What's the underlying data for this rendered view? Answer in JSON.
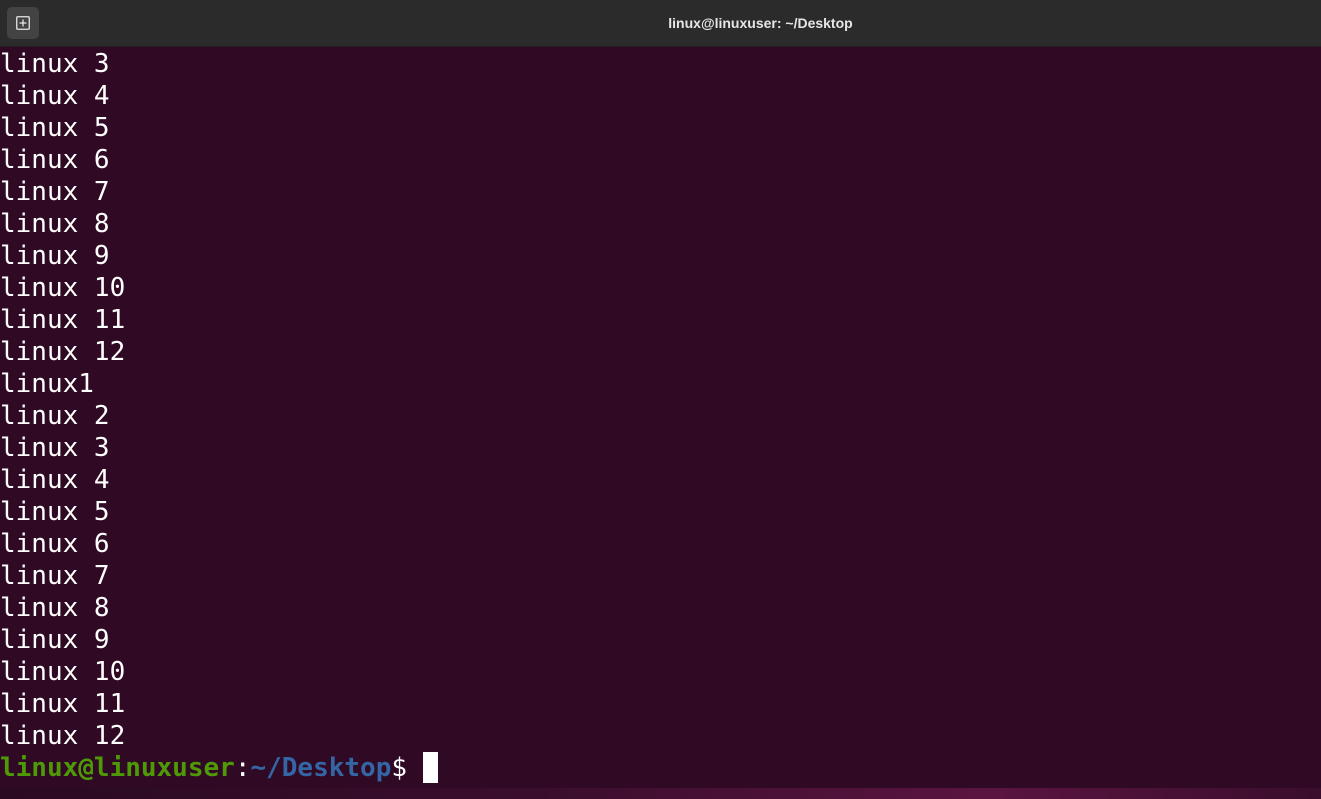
{
  "window": {
    "title": "linux@linuxuser: ~/Desktop"
  },
  "icons": {
    "new_tab": "new-tab-icon"
  },
  "colors": {
    "background": "#300a24",
    "titlebar": "#2b2b2b",
    "prompt_user": "#4e9a06",
    "prompt_path": "#3465a4",
    "text": "#ffffff"
  },
  "output_lines": [
    "linux 3",
    "linux 4",
    "linux 5",
    "linux 6",
    "linux 7",
    "linux 8",
    "linux 9",
    "linux 10",
    "linux 11",
    "linux 12",
    "linux1",
    "linux 2",
    "linux 3",
    "linux 4",
    "linux 5",
    "linux 6",
    "linux 7",
    "linux 8",
    "linux 9",
    "linux 10",
    "linux 11",
    "linux 12"
  ],
  "prompt": {
    "user_host": "linux@linuxuser",
    "colon": ":",
    "path": "~/Desktop",
    "symbol": "$ "
  }
}
